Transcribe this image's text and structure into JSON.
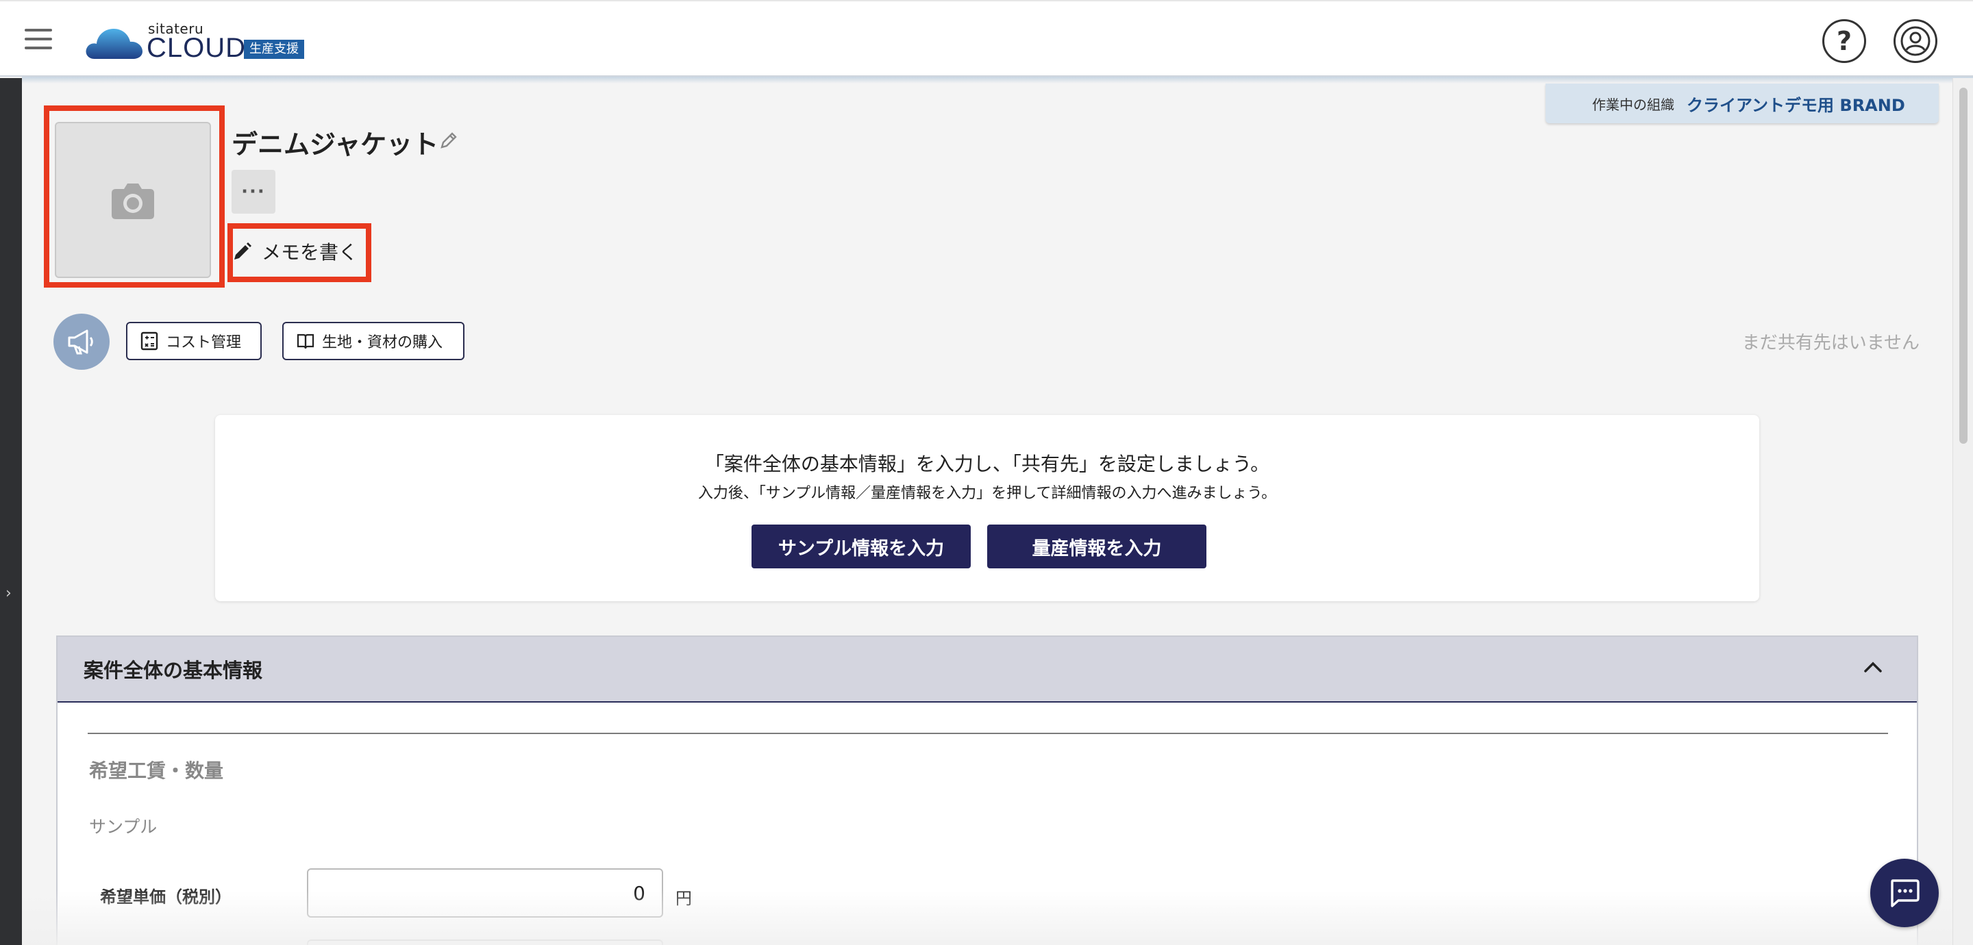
{
  "header": {
    "logo_small": "sitateru",
    "logo_big": "CLOUD",
    "logo_badge": "生産支援",
    "icons": [
      "hamburger-menu-icon",
      "help-icon",
      "user-account-icon"
    ]
  },
  "org": {
    "label": "作業中の組織",
    "value": "クライアントデモ用 BRAND"
  },
  "product": {
    "title": "デニムジャケット",
    "memo_label": "メモを書く",
    "more_label": "···"
  },
  "actions": {
    "cost_label": "コスト管理",
    "fabric_label": "生地・資材の購入",
    "no_share_text": "まだ共有先はいません"
  },
  "card": {
    "line1": "「案件全体の基本情報」を入力し、「共有先」を設定しましょう。",
    "line2": "入力後、「サンプル情報／量産情報を入力」を押して詳細情報の入力へ進みましょう。",
    "sample_button": "サンプル情報を入力",
    "mass_button": "量産情報を入力"
  },
  "section": {
    "title": "案件全体の基本情報",
    "subheading": "希望工賃・数量",
    "group": "サンプル",
    "field_label": "希望単価（税別）",
    "field_value": "0",
    "field_unit": "円"
  },
  "colors": {
    "accent_navy": "#24245a",
    "highlight_red": "#e8391e",
    "org_tab_bg": "#d7e3ee"
  }
}
